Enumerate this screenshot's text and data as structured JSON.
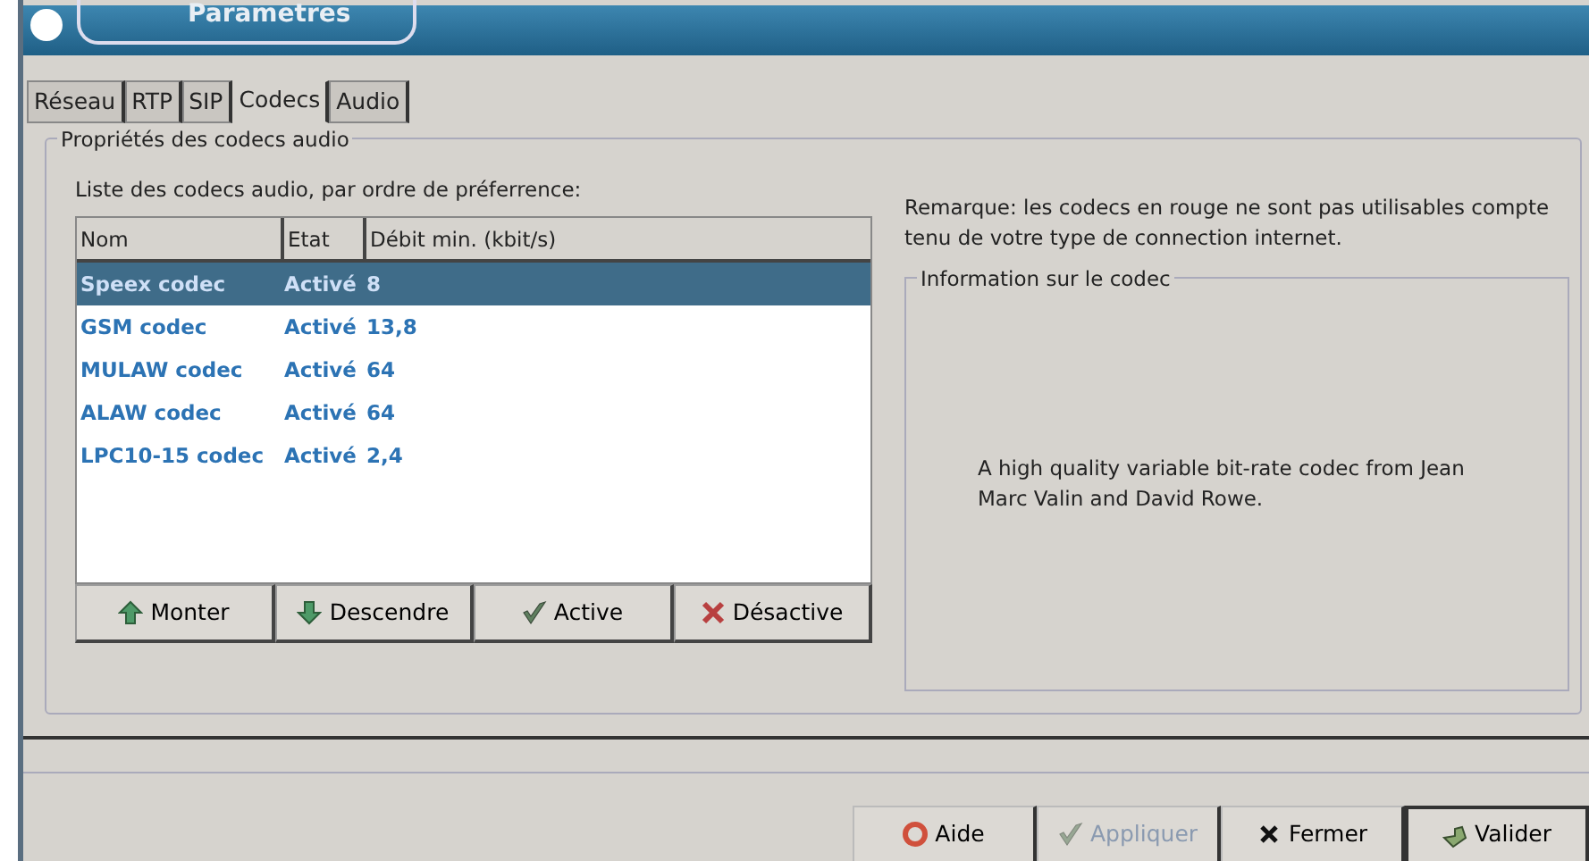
{
  "window": {
    "title": "Parametres"
  },
  "tabs": [
    {
      "label": "Réseau",
      "selected": false
    },
    {
      "label": "RTP",
      "selected": false
    },
    {
      "label": "SIP",
      "selected": false
    },
    {
      "label": "Codecs",
      "selected": true
    },
    {
      "label": "Audio",
      "selected": false
    }
  ],
  "group": {
    "title": "Propriétés des codecs audio"
  },
  "list_label": "Liste des codecs audio, par ordre de préferrence:",
  "table": {
    "columns": [
      "Nom",
      "Etat",
      "Débit min. (kbit/s)"
    ],
    "rows": [
      {
        "cells": [
          "Speex codec",
          "Activé",
          "8"
        ],
        "selected": true
      },
      {
        "cells": [
          "GSM codec",
          "Activé",
          "13,8"
        ],
        "selected": false
      },
      {
        "cells": [
          "MULAW codec",
          "Activé",
          "64"
        ],
        "selected": false
      },
      {
        "cells": [
          "ALAW codec",
          "Activé",
          "64"
        ],
        "selected": false
      },
      {
        "cells": [
          "LPC10-15 codec",
          "Activé",
          "2,4"
        ],
        "selected": false
      }
    ]
  },
  "list_buttons": [
    {
      "label": "Monter",
      "kind": "up"
    },
    {
      "label": "Descendre",
      "kind": "down"
    },
    {
      "label": "Active",
      "kind": "check"
    },
    {
      "label": "Désactive",
      "kind": "cross"
    }
  ],
  "remark": "Remarque: les codecs en rouge ne sont pas utilisables compte tenu de votre type de connection internet.",
  "info": {
    "title": "Information sur le codec",
    "text": "A high quality variable bit-rate codec from Jean Marc Valin and David Rowe."
  },
  "buttons": [
    {
      "label": "Aide",
      "kind": "help",
      "disabled": false,
      "default": false
    },
    {
      "label": "Appliquer",
      "kind": "check",
      "disabled": true,
      "default": false
    },
    {
      "label": "Fermer",
      "kind": "close",
      "disabled": false,
      "default": false
    },
    {
      "label": "Valider",
      "kind": "ok",
      "disabled": false,
      "default": true
    }
  ]
}
